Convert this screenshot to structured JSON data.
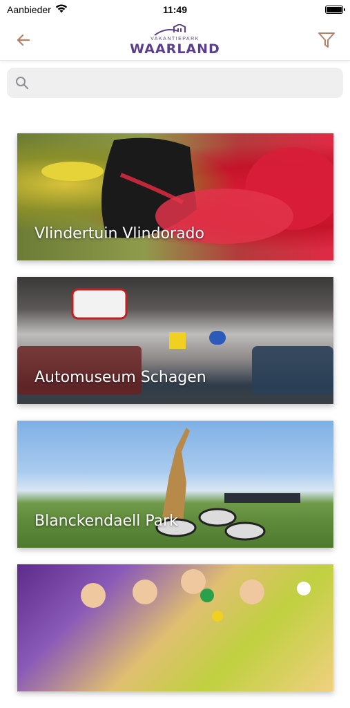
{
  "status": {
    "carrier": "Aanbieder",
    "time": "11:49"
  },
  "navbar": {
    "logo_top": "VAKANTIEPARK",
    "logo_main": "WAARLAND"
  },
  "search": {
    "placeholder": "",
    "value": ""
  },
  "cards": [
    {
      "title": "Vlindertuin Vlindorado"
    },
    {
      "title": "Automuseum Schagen"
    },
    {
      "title": "Blanckendaell Park"
    },
    {
      "title": ""
    }
  ],
  "colors": {
    "accent": "#5a3f8e",
    "nav_icon": "#b5806a"
  }
}
